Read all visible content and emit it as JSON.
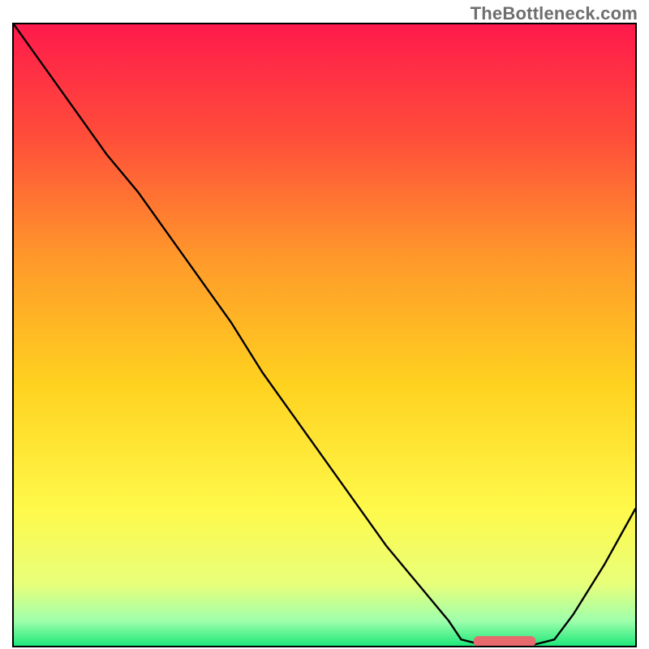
{
  "watermark": "TheBottleneck.com",
  "chart_data": {
    "type": "line",
    "title": "",
    "xlabel": "",
    "ylabel": "",
    "xlim": [
      0,
      100
    ],
    "ylim": [
      0,
      100
    ],
    "background_gradient": [
      {
        "y": 100,
        "color": "#ff1a4b"
      },
      {
        "y": 70,
        "color": "#ff7a2e"
      },
      {
        "y": 45,
        "color": "#ffcc1f"
      },
      {
        "y": 22,
        "color": "#fff94a"
      },
      {
        "y": 8,
        "color": "#d8ff83"
      },
      {
        "y": 1.5,
        "color": "#1fe87a"
      }
    ],
    "series": [
      {
        "name": "bottleneck-curve",
        "x": [
          0,
          5,
          10,
          15,
          20,
          25,
          30,
          35,
          40,
          45,
          50,
          55,
          60,
          65,
          70,
          72,
          76,
          80,
          83,
          87,
          90,
          95,
          100
        ],
        "y": [
          100,
          93,
          86,
          79,
          73,
          66,
          59,
          52,
          44,
          37,
          30,
          23,
          16,
          10,
          4,
          1,
          0,
          0,
          0,
          1,
          5,
          13,
          22
        ]
      }
    ],
    "annotations": [
      {
        "name": "optimal-range-marker",
        "shape": "rounded-bar",
        "x_start": 74,
        "x_end": 84,
        "y": 0.7,
        "color": "#e76a6f"
      }
    ]
  }
}
